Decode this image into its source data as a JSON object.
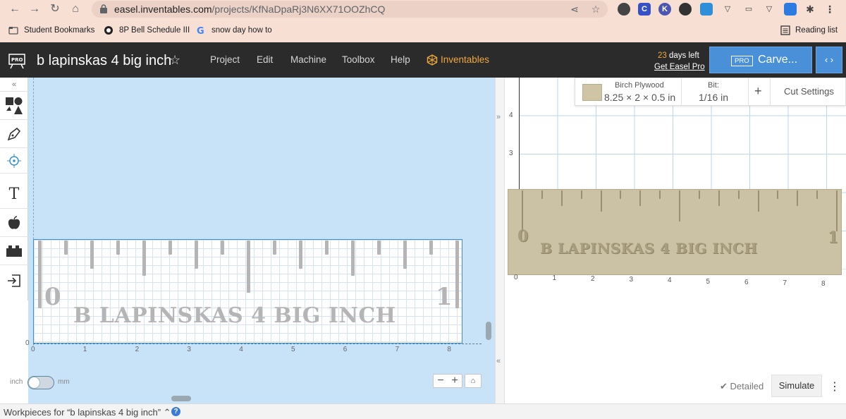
{
  "browser": {
    "url_host": "easel.inventables.com",
    "url_path": "/projects/KfNaDpaRj3N6XX71OOZhCQ",
    "bookmarks": [
      {
        "label": "Student Bookmarks"
      },
      {
        "label": "8P Bell Schedule III"
      },
      {
        "label": "snow day how to"
      }
    ],
    "reading_list": "Reading list"
  },
  "header": {
    "project_title": "b lapinskas 4 big inch",
    "menu": [
      "Project",
      "Edit",
      "Machine",
      "Toolbox",
      "Help",
      "Inventables"
    ],
    "trial_days": "23",
    "trial_suffix": " days left",
    "get_pro": "Get Easel Pro",
    "carve_badge": "PRO",
    "carve_label": "Carve..."
  },
  "design": {
    "ruler_text": "B LAPINSKAS 4 BIG INCH",
    "ruler_zero": "0",
    "ruler_one": "1",
    "x_axis_labels": [
      "0",
      "1",
      "2",
      "3",
      "4",
      "5",
      "6",
      "7",
      "8"
    ],
    "y_axis_label": "0",
    "unit_left": "inch",
    "unit_right": "mm"
  },
  "material": {
    "name": "Birch Plywood",
    "dimensions": "8.25 × 2 × 0.5 in",
    "bit_label": "Bit:",
    "bit_value": "1/16 in",
    "cut_settings": "Cut Settings"
  },
  "preview": {
    "ruler_text": "B LAPINSKAS 4 BIG INCH",
    "ruler_zero": "0",
    "ruler_one": "1",
    "x_axis_labels": [
      "0",
      "1",
      "2",
      "3",
      "4",
      "5",
      "6",
      "7",
      "8"
    ],
    "y_axis_labels": [
      "3",
      "4"
    ],
    "detailed": "Detailed",
    "simulate": "Simulate"
  },
  "footer": {
    "workpieces": "Workpieces for “b lapinskas 4 big inch”"
  },
  "colors": {
    "accent": "#4a90d9",
    "header_bg": "#2b2b2b",
    "inventables_orange": "#f2a93b",
    "canvas_bg": "#c8e2f8",
    "wood": "#cbc1a4"
  }
}
